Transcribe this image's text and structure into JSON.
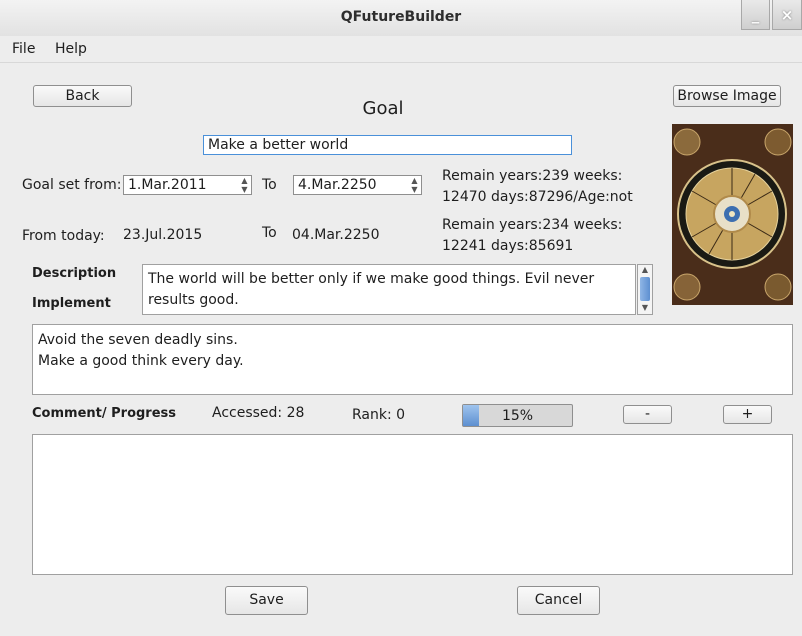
{
  "window": {
    "title": "QFutureBuilder",
    "minimize_label": "_",
    "close_label": "×"
  },
  "menu": {
    "items": [
      {
        "label": "File"
      },
      {
        "label": "Help"
      }
    ]
  },
  "header": {
    "back_label": "Back",
    "heading": "Goal",
    "browse_label": "Browse Image"
  },
  "goal_name": "Make a better world",
  "goal_dates": {
    "from_label": "Goal set from:",
    "start": "1.Mar.2011",
    "to_label": "To",
    "end": "4.Mar.2250",
    "remain_line1": "Remain years:239 weeks:",
    "remain_line2": "12470 days:87296/Age:not"
  },
  "today_dates": {
    "from_label": "From today:",
    "start": "23.Jul.2015",
    "to_label": "To",
    "end": "04.Mar.2250",
    "remain_line1": "Remain years:234 weeks:",
    "remain_line2": "12241 days:85691"
  },
  "description": {
    "label": "Description",
    "text": "The world will be better only if we make good things. Evil never results good."
  },
  "implement": {
    "label": "Implement",
    "text": "Avoid the seven deadly sins.\nMake a good think every day."
  },
  "progress_row": {
    "comment_label": "Comment/ Progress",
    "accessed": "Accessed: 28",
    "rank": "Rank: 0",
    "progress_percent": 15,
    "progress_text": "15%",
    "minus_label": "-",
    "plus_label": "+"
  },
  "comment_text": "",
  "footer": {
    "save_label": "Save",
    "cancel_label": "Cancel"
  },
  "colors": {
    "background": "#ededed",
    "progress_fill": "#5d8fd0",
    "focus_border": "#4a90d9"
  }
}
